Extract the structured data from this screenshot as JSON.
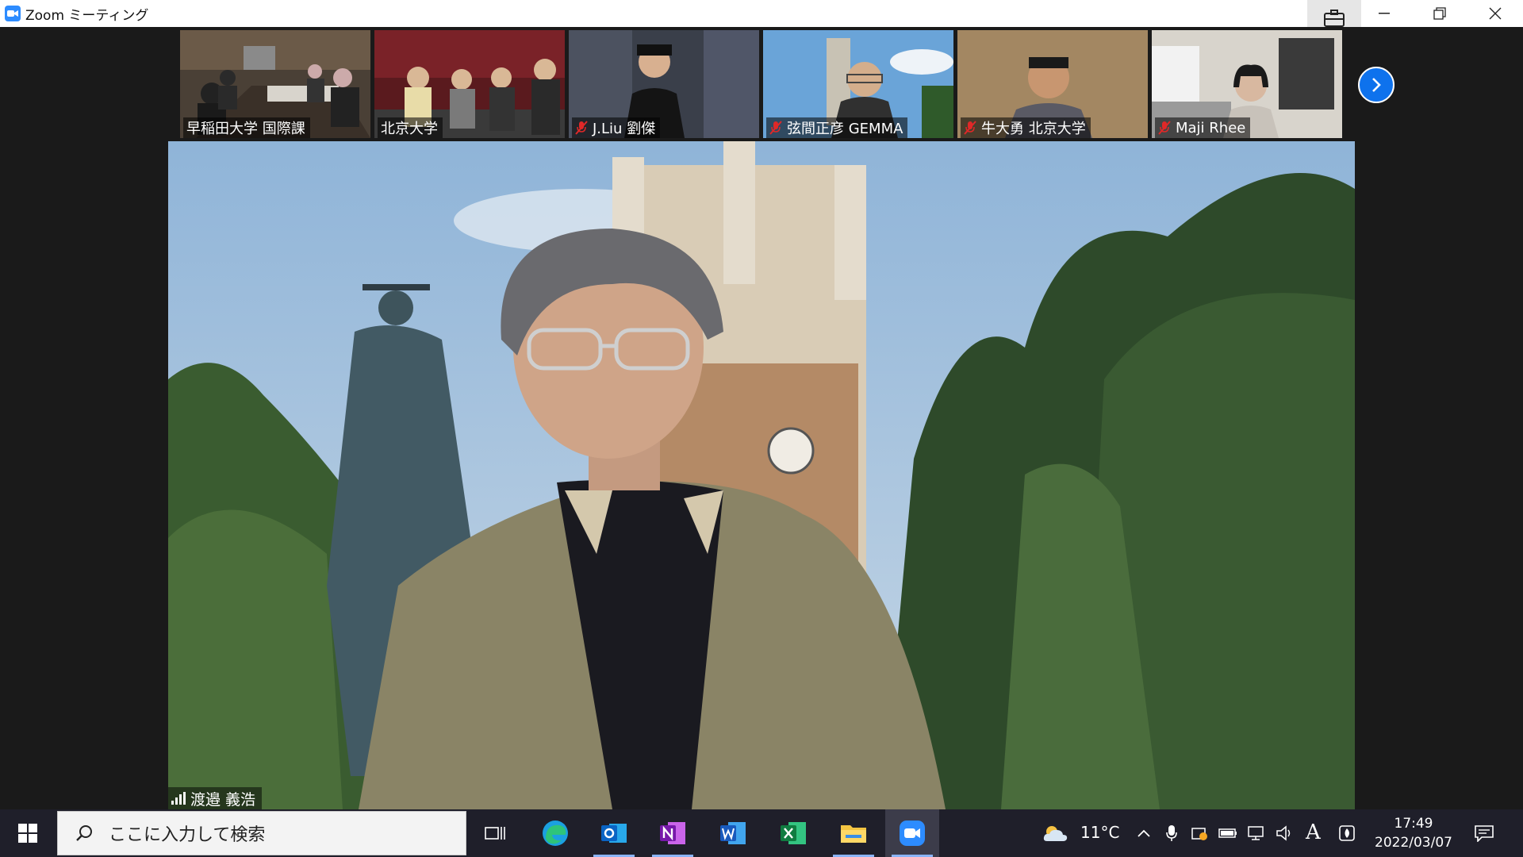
{
  "window": {
    "title": "Zoom ミーティング"
  },
  "thumbnails": [
    {
      "name": "早稲田大学 国際課",
      "muted": false
    },
    {
      "name": "北京大学",
      "muted": false
    },
    {
      "name": "J.Liu 劉傑",
      "muted": true
    },
    {
      "name": "弦間正彦  GEMMA",
      "muted": true
    },
    {
      "name": "牛大勇  北京大学",
      "muted": true
    },
    {
      "name": "Maji Rhee",
      "muted": true
    }
  ],
  "main_speaker": {
    "name": "渡邉 義浩"
  },
  "taskbar": {
    "search_placeholder": "ここに入力して検索",
    "apps": [
      "task-view",
      "edge",
      "outlook",
      "onenote",
      "word",
      "excel",
      "file-explorer",
      "zoom"
    ],
    "weather": "11°C",
    "ime": "A",
    "time": "17:49",
    "date": "2022/03/07"
  },
  "colors": {
    "zoom_blue": "#2d8cff",
    "next_button": "#0e72ed",
    "taskbar": "#1f1f2a"
  }
}
